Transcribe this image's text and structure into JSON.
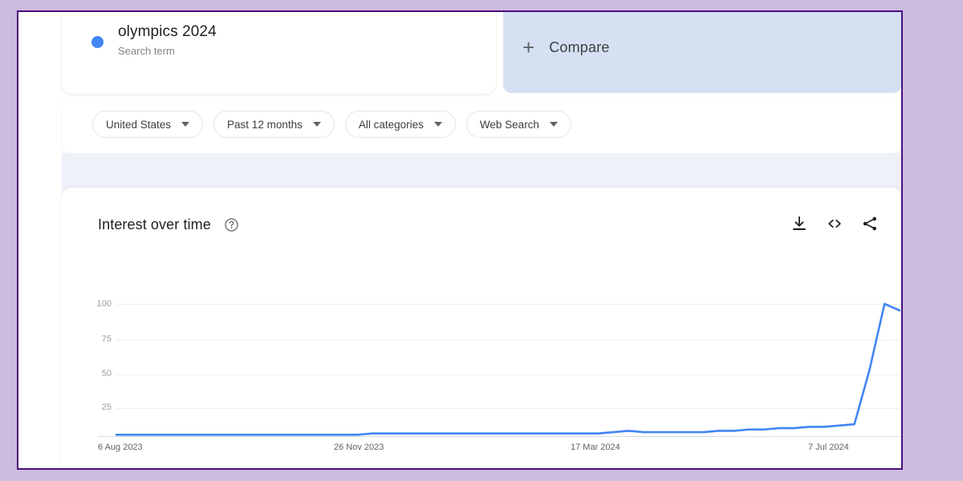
{
  "colors": {
    "series_blue": "#4285f4",
    "compare_panel": "#d5e0f2",
    "band": "#eef1f8",
    "page_border": "#4b0d7a",
    "page_bg": "#cdbbe0"
  },
  "term": {
    "title": "olympics 2024",
    "subtitle": "Search term",
    "dot_icon": "series-color-dot"
  },
  "compare": {
    "label": "Compare",
    "plus_icon": "plus-icon"
  },
  "filters": [
    {
      "label": "United States",
      "icon": "chevron-down-icon"
    },
    {
      "label": "Past 12 months",
      "icon": "chevron-down-icon"
    },
    {
      "label": "All categories",
      "icon": "chevron-down-icon"
    },
    {
      "label": "Web Search",
      "icon": "chevron-down-icon"
    }
  ],
  "chart_header": {
    "title": "Interest over time",
    "help_icon": "help-circle-icon",
    "actions": [
      {
        "name": "download-icon",
        "label": "Download"
      },
      {
        "name": "embed-code-icon",
        "label": "Embed"
      },
      {
        "name": "share-icon",
        "label": "Share"
      }
    ]
  },
  "chart_data": {
    "type": "line",
    "title": "Interest over time",
    "xlabel": "",
    "ylabel": "",
    "ylim": [
      0,
      100
    ],
    "yticks": [
      100,
      75,
      50,
      25
    ],
    "xticks": [
      "6 Aug 2023",
      "26 Nov 2023",
      "17 Mar 2024",
      "7 Jul 2024"
    ],
    "grid": true,
    "legend": "olympics 2024",
    "series": [
      {
        "name": "olympics 2024",
        "color": "#4285f4",
        "x": [
          "6 Aug 2023",
          "13 Aug 2023",
          "20 Aug 2023",
          "27 Aug 2023",
          "3 Sep 2023",
          "10 Sep 2023",
          "17 Sep 2023",
          "24 Sep 2023",
          "1 Oct 2023",
          "8 Oct 2023",
          "15 Oct 2023",
          "22 Oct 2023",
          "29 Oct 2023",
          "5 Nov 2023",
          "12 Nov 2023",
          "19 Nov 2023",
          "26 Nov 2023",
          "3 Dec 2023",
          "10 Dec 2023",
          "17 Dec 2023",
          "24 Dec 2023",
          "31 Dec 2023",
          "7 Jan 2024",
          "14 Jan 2024",
          "21 Jan 2024",
          "28 Jan 2024",
          "4 Feb 2024",
          "11 Feb 2024",
          "18 Feb 2024",
          "25 Feb 2024",
          "3 Mar 2024",
          "10 Mar 2024",
          "17 Mar 2024",
          "24 Mar 2024",
          "31 Mar 2024",
          "7 Apr 2024",
          "14 Apr 2024",
          "21 Apr 2024",
          "28 Apr 2024",
          "5 May 2024",
          "12 May 2024",
          "19 May 2024",
          "26 May 2024",
          "2 Jun 2024",
          "9 Jun 2024",
          "16 Jun 2024",
          "23 Jun 2024",
          "30 Jun 2024",
          "7 Jul 2024",
          "14 Jul 2024",
          "21 Jul 2024",
          "28 Jul 2024",
          "4 Aug 2024"
        ],
        "values": [
          1,
          1,
          1,
          1,
          1,
          1,
          1,
          1,
          1,
          1,
          1,
          1,
          1,
          1,
          1,
          1,
          1,
          2,
          2,
          2,
          2,
          2,
          2,
          2,
          2,
          2,
          2,
          2,
          2,
          2,
          2,
          2,
          2,
          3,
          4,
          3,
          3,
          3,
          3,
          3,
          4,
          4,
          5,
          5,
          6,
          6,
          7,
          7,
          8,
          9,
          50,
          100,
          95
        ]
      }
    ]
  }
}
